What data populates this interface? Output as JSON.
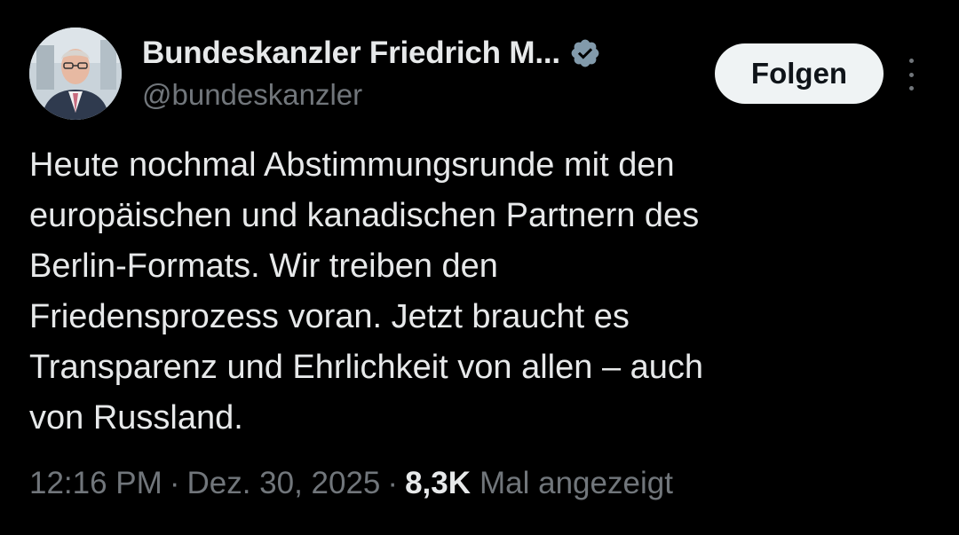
{
  "author": {
    "display_name": "Bundeskanzler Friedrich M...",
    "handle": "@bundeskanzler",
    "avatar_icon": "profile-photo",
    "verified_icon": "verified-badge-icon",
    "verified_color": "#829aab"
  },
  "actions": {
    "follow_label": "Folgen",
    "more_icon": "more-vertical-icon"
  },
  "tweet": {
    "lines": [
      "Heute nochmal Abstimmungsrunde mit den",
      "europäischen und kanadischen Partnern des",
      "Berlin-Formats. Wir treiben den",
      "Friedensprozess voran. Jetzt braucht es",
      "Transparenz und Ehrlichkeit von allen – auch",
      "von Russland."
    ]
  },
  "meta": {
    "time": "12:16 PM",
    "separator": "·",
    "date": "Dez. 30, 2025",
    "views_count": "8,3K",
    "views_label": "Mal angezeigt"
  },
  "colors": {
    "background": "#000000",
    "primary_text": "#e7e9ea",
    "secondary_text": "#71767b",
    "button_bg": "#eff3f4",
    "button_text": "#0f1419"
  }
}
